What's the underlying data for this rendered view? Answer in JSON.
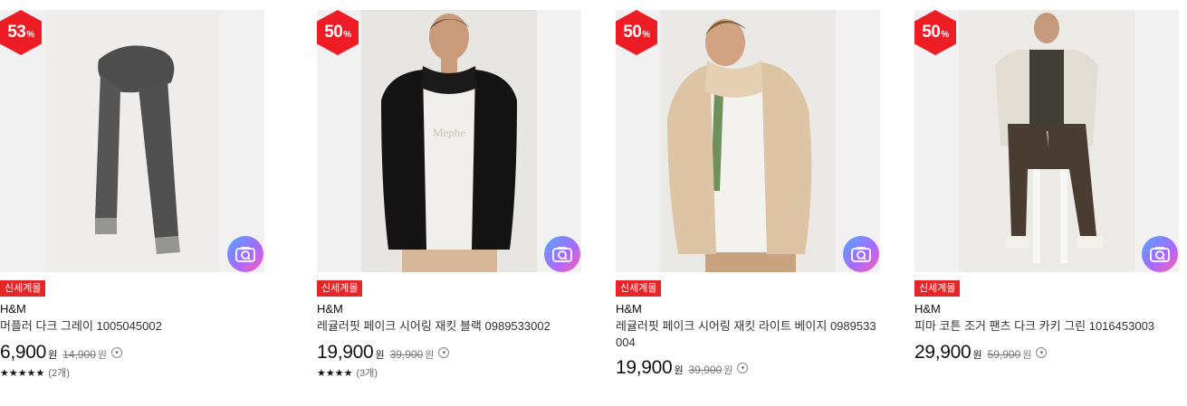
{
  "products": [
    {
      "discount_num": "50",
      "discount_unit": "%",
      "tag": "신세계몰",
      "brand": "H&M",
      "title": "레귤러핏 페이크 시어링 재킷 블랙 0989533002",
      "price": "19,900",
      "price_unit": "원",
      "original_price": "39,900",
      "original_unit": "원",
      "stars": "★★★★",
      "stars_value": 4,
      "review_count": "(3개)",
      "image": "black teddy fleece jacket on model"
    },
    {
      "discount_num": "50",
      "discount_unit": "%",
      "tag": "신세계몰",
      "brand": "H&M",
      "title": "레귤러핏 페이크 시어링 재킷 라이트 베이지 0989533004",
      "price": "19,900",
      "price_unit": "원",
      "original_price": "39,900",
      "original_unit": "원",
      "image": "light beige teddy fleece jacket on model"
    },
    {
      "discount_num": "50",
      "discount_unit": "%",
      "tag": "신세계몰",
      "brand": "H&M",
      "title": "피마 코튼 조거 팬츠 다크 카키 그린 1016453003",
      "price": "29,900",
      "price_unit": "원",
      "original_price": "59,900",
      "original_unit": "원",
      "image": "seated model in dark khaki jogger pants"
    },
    {
      "discount_num": "53",
      "discount_unit": "%",
      "tag": "신세계몰",
      "brand": "H&M",
      "title": "머플러 다크 그레이 1005045002",
      "price": "6,900",
      "price_unit": "원",
      "original_price": "14,900",
      "original_unit": "원",
      "stars": "★★★★★",
      "stars_value": 5,
      "review_count": "(2개)",
      "image": "dark grey scarf"
    }
  ],
  "icons": {
    "camera": "camera-search-icon",
    "info": "chevron-circle-icon",
    "star": "star-icon"
  },
  "colors": {
    "discount_badge": "#ee1c25",
    "tag": "#e52528",
    "camera_gradient_start": "#4fa8ff",
    "camera_gradient_end": "#ff5fb0"
  }
}
